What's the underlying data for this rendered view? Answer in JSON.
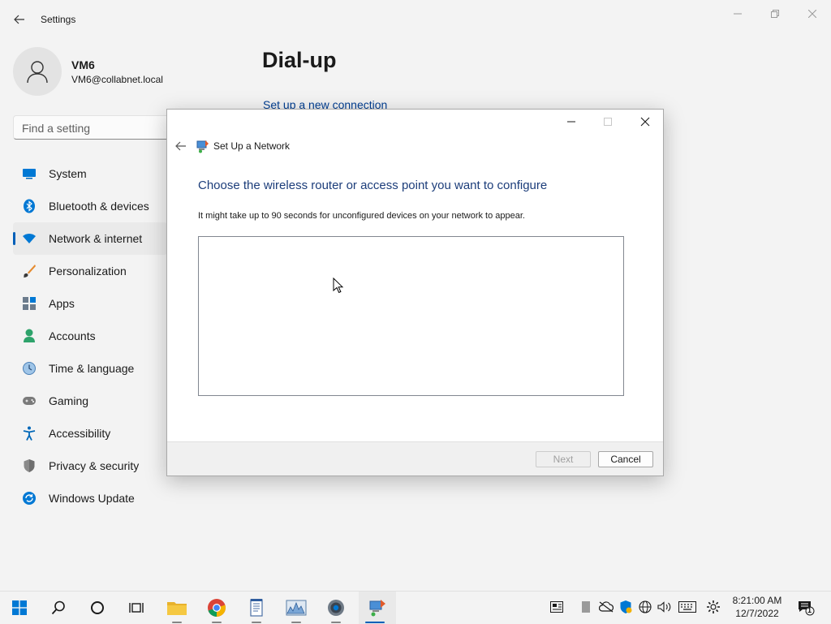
{
  "window": {
    "title": "Settings"
  },
  "profile": {
    "name": "VM6",
    "email": "VM6@collabnet.local"
  },
  "search": {
    "placeholder": "Find a setting"
  },
  "nav": [
    {
      "label": "System",
      "icon": "system-icon"
    },
    {
      "label": "Bluetooth & devices",
      "icon": "bluetooth-icon"
    },
    {
      "label": "Network & internet",
      "icon": "wifi-icon",
      "selected": true
    },
    {
      "label": "Personalization",
      "icon": "brush-icon"
    },
    {
      "label": "Apps",
      "icon": "apps-icon"
    },
    {
      "label": "Accounts",
      "icon": "accounts-icon"
    },
    {
      "label": "Time & language",
      "icon": "clock-icon"
    },
    {
      "label": "Gaming",
      "icon": "gamepad-icon"
    },
    {
      "label": "Accessibility",
      "icon": "accessibility-icon"
    },
    {
      "label": "Privacy & security",
      "icon": "shield-icon"
    },
    {
      "label": "Windows Update",
      "icon": "update-icon"
    }
  ],
  "page": {
    "title": "Dial-up",
    "link": "Set up a new connection"
  },
  "dialog": {
    "title": "Set Up a Network",
    "heading": "Choose the wireless router or access point you want to configure",
    "description": "It might take up to 90 seconds for unconfigured devices on your network to appear.",
    "next_label": "Next",
    "cancel_label": "Cancel"
  },
  "taskbar": {
    "apps": [
      "start-icon",
      "search-icon",
      "cortana-icon",
      "task-view-icon",
      "file-explorer-icon",
      "chrome-icon",
      "notepad-icon",
      "performance-monitor-icon",
      "settings-gear-icon",
      "network-setup-icon"
    ],
    "time": "8:21:00 AM",
    "date": "12/7/2022",
    "notification_count": "1"
  },
  "colors": {
    "accent": "#005fb8",
    "heading_blue": "#1c3d7a",
    "link_blue": "#003e92"
  }
}
